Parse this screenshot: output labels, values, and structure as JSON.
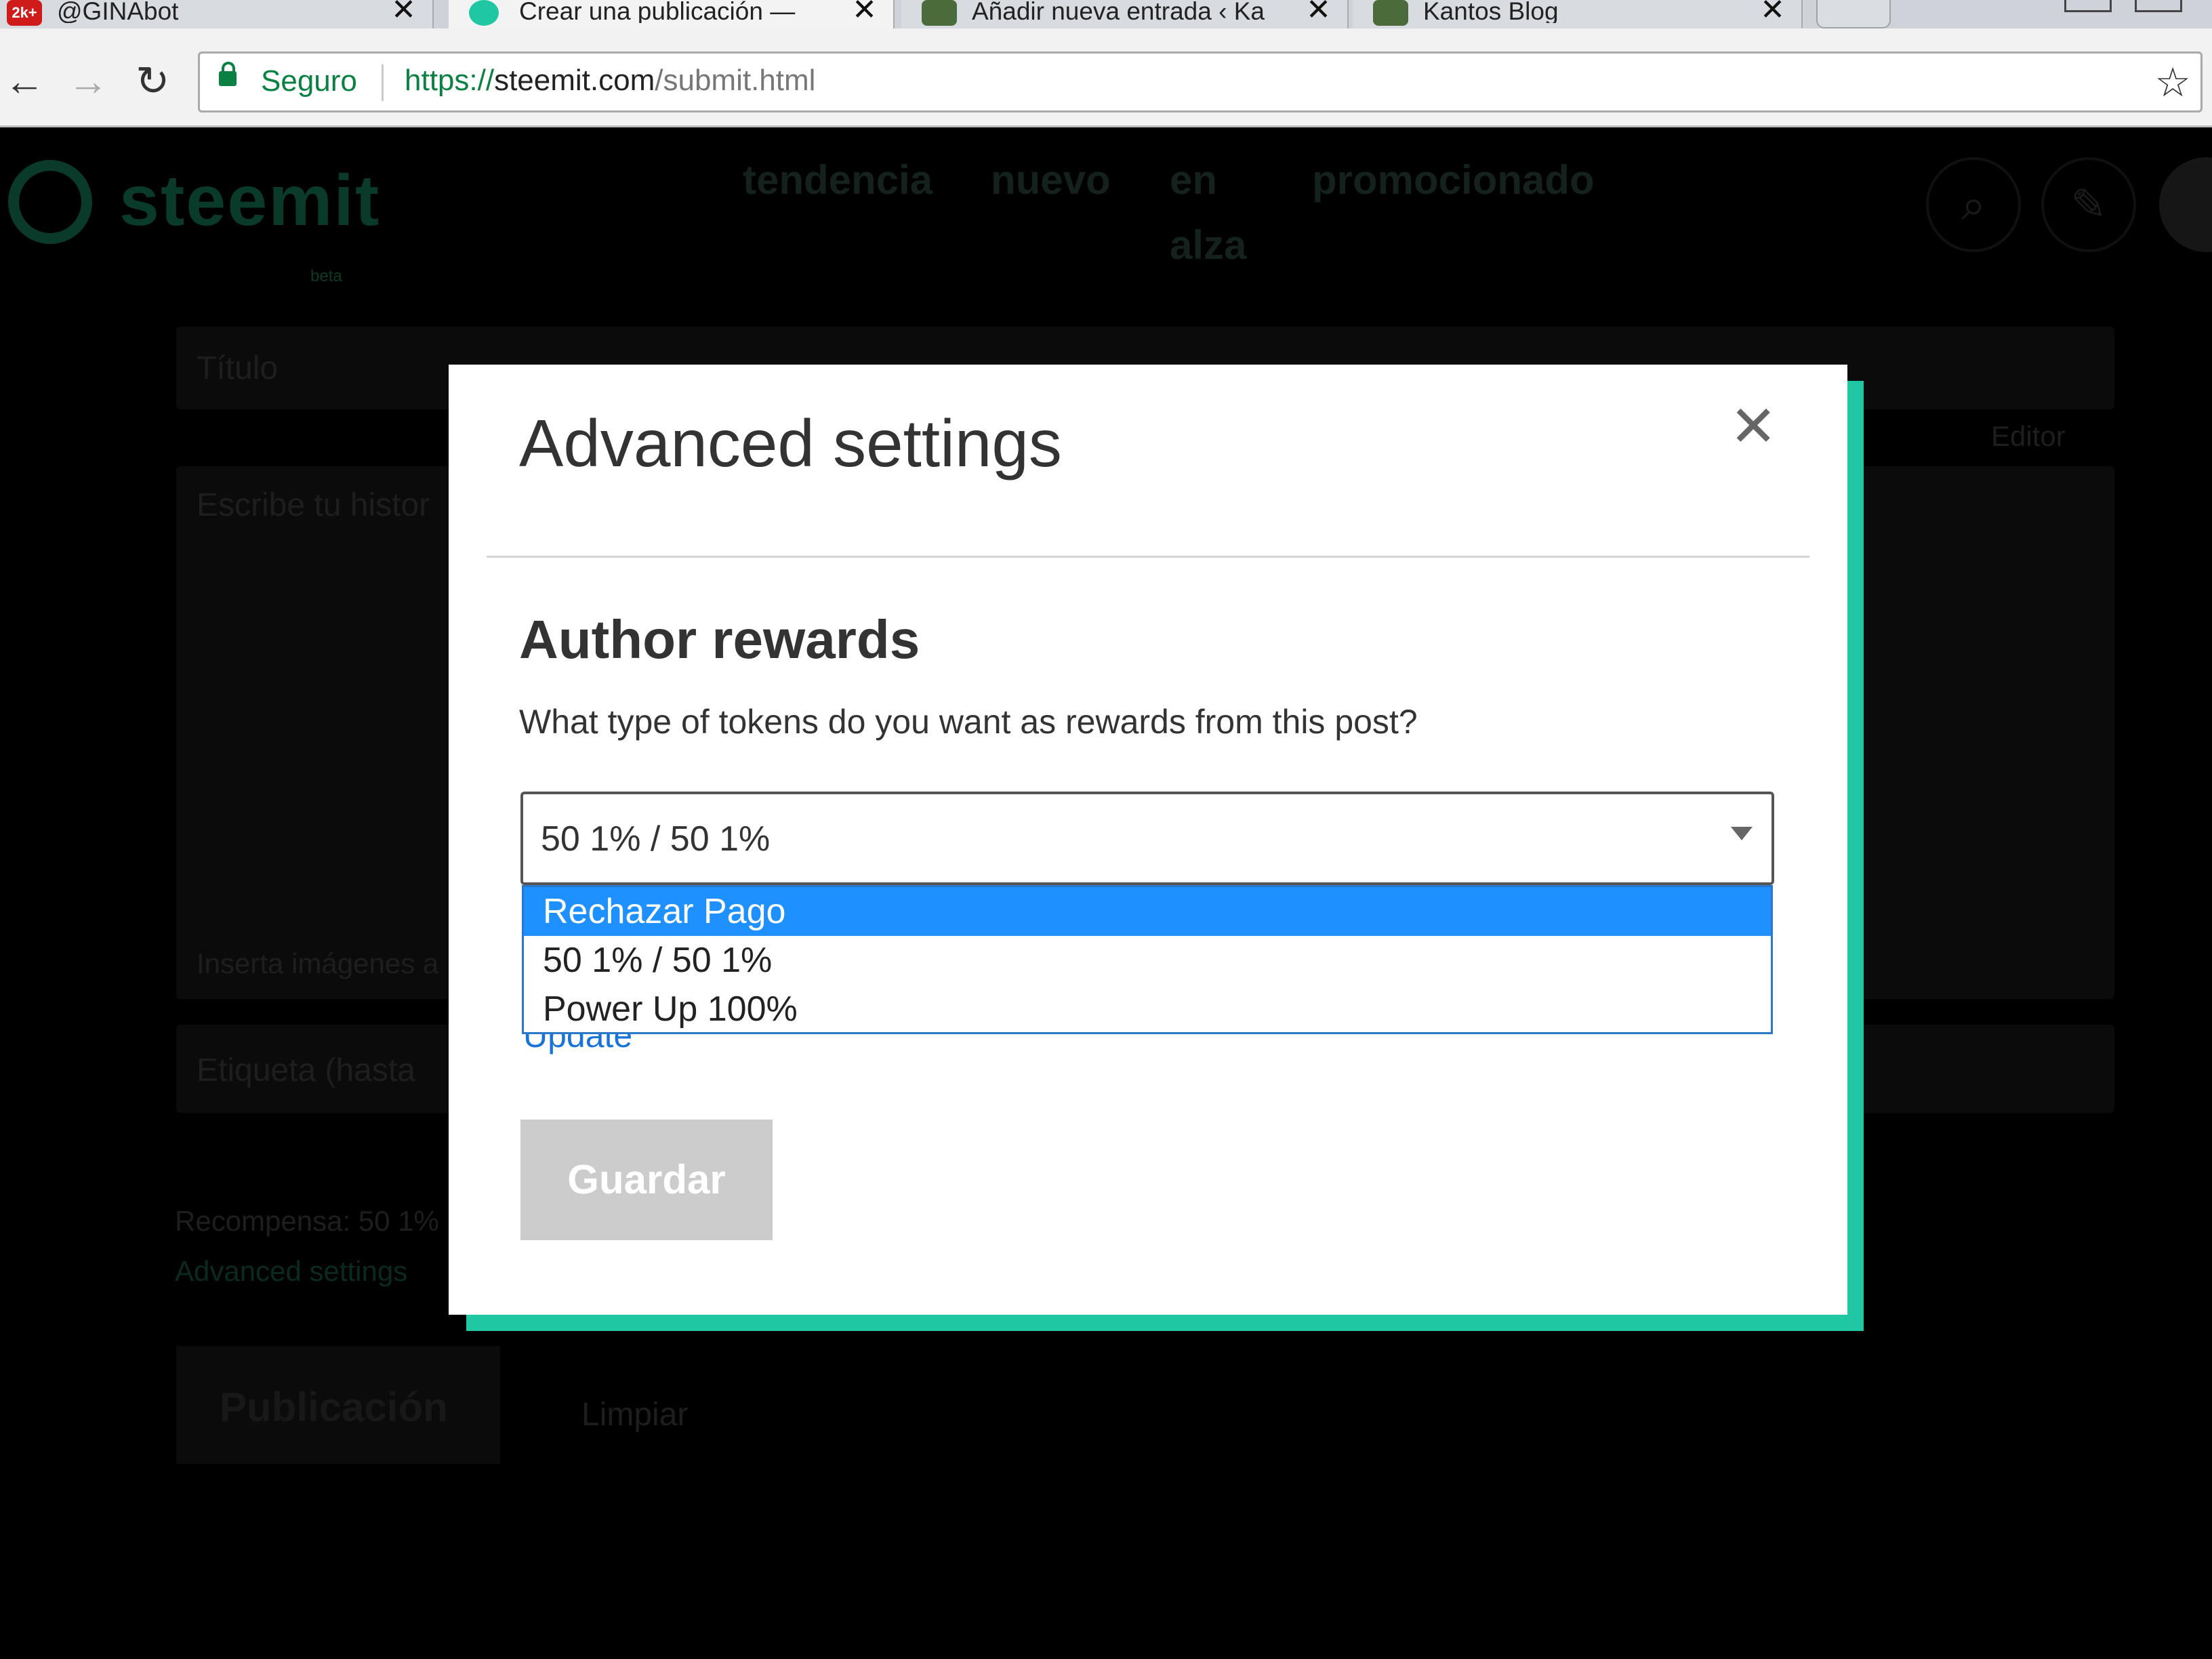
{
  "browser": {
    "tabs": [
      {
        "title": "@GINAbot",
        "badge": "2k+"
      },
      {
        "title": "Crear una publicación —",
        "active": true
      },
      {
        "title": "Añadir nueva entrada ‹ Ka"
      },
      {
        "title": "Kantos Blog"
      }
    ],
    "secure_label": "Seguro",
    "url_scheme": "https://",
    "url_host": "steemit.com",
    "url_path": "/submit.html"
  },
  "page": {
    "logo_text": "steemit",
    "logo_beta": "beta",
    "nav": [
      "tendencia",
      "nuevo",
      "en alza",
      "promocionado"
    ],
    "title_placeholder": "Título",
    "editor_link": "Editor",
    "body_placeholder": "Escribe tu histor",
    "insert_images": "Inserta imágenes a",
    "tags_placeholder": "Etiqueta (hasta",
    "reward_summary": "Recompensa: 50 1%",
    "advanced_link": "Advanced settings",
    "publish_label": "Publicación",
    "clear_label": "Limpiar"
  },
  "modal": {
    "title": "Advanced settings",
    "close_icon": "close-icon",
    "section_title": "Author rewards",
    "question": "What type of tokens do you want as rewards from this post?",
    "select_value": "50 1% / 50 1%",
    "options": [
      "Rechazar Pago",
      "50 1% / 50 1%",
      "Power Up 100%"
    ],
    "highlighted_option": "Rechazar Pago",
    "update_link": "Update",
    "save_label": "Guardar"
  },
  "colors": {
    "accent": "#1fc7a2",
    "highlight": "#1e90ff",
    "secure": "#0b8043",
    "save_disabled": "#cccccc"
  }
}
